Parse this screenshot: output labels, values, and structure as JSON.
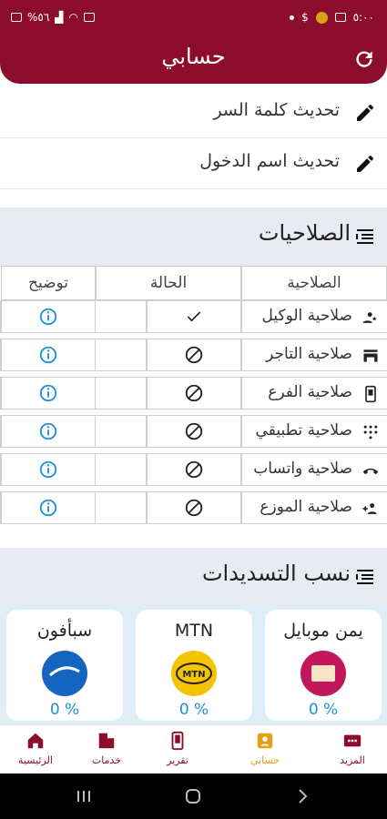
{
  "statusbar": {
    "left_text": "%٥٦",
    "time": "٥:٠٠"
  },
  "appbar": {
    "title": "حسابي"
  },
  "actions": [
    {
      "label": "تحديث كلمة السر",
      "icon": "pencil-icon"
    },
    {
      "label": "تحديث اسم الدخول",
      "icon": "pencil-icon"
    }
  ],
  "permissions": {
    "title": "الصلاحيات",
    "columns": {
      "permission": "الصلاحية",
      "status": "الحالة",
      "info": "توضيح"
    },
    "rows": [
      {
        "label": "صلاحية الوكيل",
        "icon": "agent-icon",
        "status": "granted"
      },
      {
        "label": "صلاحية التاجر",
        "icon": "store-icon",
        "status": "denied"
      },
      {
        "label": "صلاحية الفرع",
        "icon": "phone-icon",
        "status": "denied"
      },
      {
        "label": "صلاحية تطبيقي",
        "icon": "dial-pad-icon",
        "status": "denied"
      },
      {
        "label": "صلاحية واتساب",
        "icon": "phone-handset-icon",
        "status": "denied"
      },
      {
        "label": "صلاحية الموزع",
        "icon": "add-group-icon",
        "status": "denied"
      }
    ]
  },
  "payments": {
    "title": "نسب التسديدات",
    "cards": [
      {
        "name": "يمن موبايل",
        "percent": "0 %",
        "color": "#c2185b"
      },
      {
        "name": "MTN",
        "percent": "0 %",
        "color": "#f5c400"
      },
      {
        "name": "سبأفون",
        "percent": "0 %",
        "color": "#1565c0"
      }
    ]
  },
  "bottomnav": [
    {
      "label": "الرئيسية",
      "icon": "home-icon"
    },
    {
      "label": "خدمات",
      "icon": "building-icon"
    },
    {
      "label": "تقرير",
      "icon": "phone-report-icon"
    },
    {
      "label": "حسابي",
      "icon": "account-icon",
      "active": true
    },
    {
      "label": "المزيد",
      "icon": "more-icon"
    }
  ],
  "colors": {
    "brand": "#8b0d2b",
    "accent": "#e6a014",
    "info": "#1e90d8"
  }
}
